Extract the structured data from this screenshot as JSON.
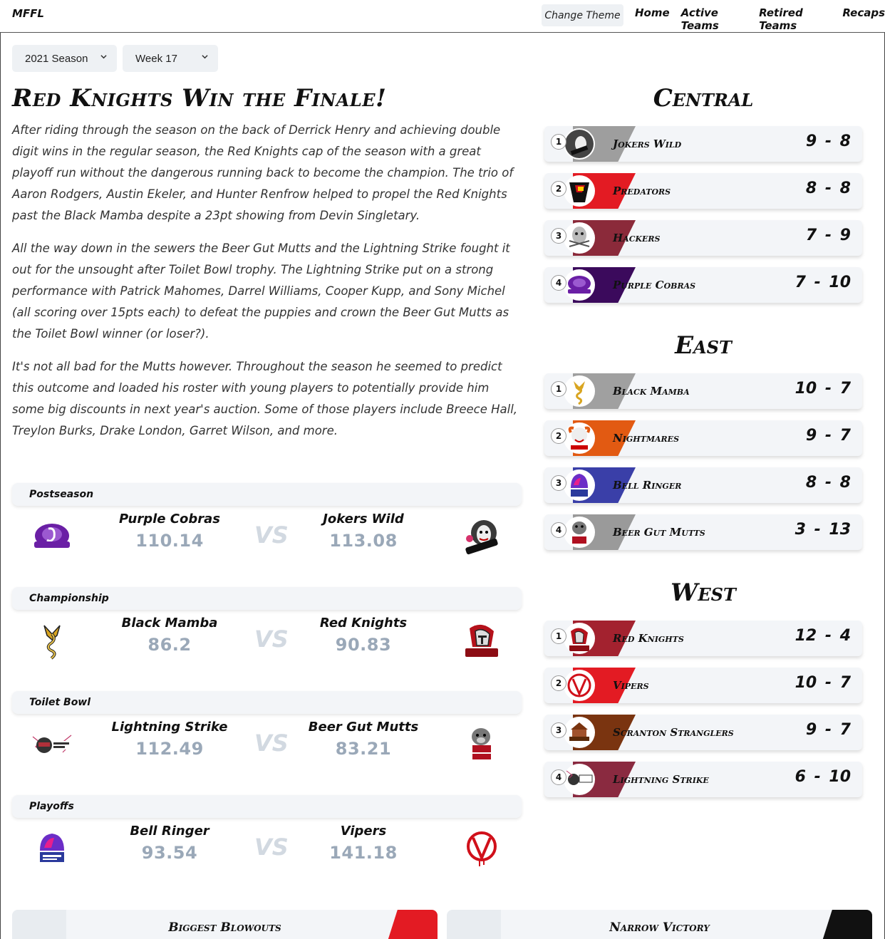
{
  "nav": {
    "brand": "MFFL",
    "change_theme": "Change Theme",
    "links": [
      "Home",
      "Active Teams",
      "Retired Teams",
      "Recaps"
    ]
  },
  "filters": {
    "season": "2021 Season",
    "week": "Week 17"
  },
  "article": {
    "headline": "Red Knights Win the Finale!",
    "paragraphs": [
      "After riding through the season on the back of Derrick Henry and achieving double digit wins in the regular season, the Red Knights cap of the season with a great playoff run without the dangerous running back to become the champion. The trio of Aaron Rodgers, Austin Ekeler, and Hunter Renfrow helped to propel the Red Knights past the Black Mamba despite a 23pt showing from Devin Singletary.",
      "All the way down in the sewers the Beer Gut Mutts and the Lightning Strike fought it out for the unsought after Toilet Bowl trophy. The Lightning Strike put on a strong performance with Patrick Mahomes, Darrel Williams, Cooper Kupp, and Sony Michel (all scoring over 15pts each) to defeat the puppies and crown the Beer Gut Mutts as the Toilet Bowl winner (or loser?).",
      "It's not all bad for the Mutts however. Throughout the season he seemed to predict this outcome and loaded his roster with young players to potentially provide him some big discounts in next year's auction. Some of those players include Breece Hall, Treylon Burks, Drake London, Garret Wilson, and more."
    ]
  },
  "matchups": [
    {
      "label": "Postseason",
      "home": "Purple Cobras",
      "home_score": "110.14",
      "away": "Jokers Wild",
      "away_score": "113.08",
      "vs": "VS",
      "home_logo": "purple-cobras-logo",
      "away_logo": "jokers-wild-logo"
    },
    {
      "label": "Championship",
      "home": "Black Mamba",
      "home_score": "86.2",
      "away": "Red Knights",
      "away_score": "90.83",
      "vs": "VS",
      "home_logo": "black-mamba-logo",
      "away_logo": "red-knights-logo"
    },
    {
      "label": "Toilet Bowl",
      "home": "Lightning Strike",
      "home_score": "112.49",
      "away": "Beer Gut Mutts",
      "away_score": "83.21",
      "vs": "VS",
      "home_logo": "lightning-strike-logo",
      "away_logo": "beer-gut-mutts-logo"
    },
    {
      "label": "Playoffs",
      "home": "Bell Ringer",
      "home_score": "93.54",
      "away": "Vipers",
      "away_score": "141.18",
      "vs": "VS",
      "home_logo": "bell-ringer-logo",
      "away_logo": "vipers-logo"
    }
  ],
  "standings": [
    {
      "division": "Central",
      "teams": [
        {
          "seed": "1",
          "name": "Jokers Wild",
          "record": "9 - 8",
          "color": "#9e9e9e"
        },
        {
          "seed": "2",
          "name": "Predators",
          "record": "8 - 8",
          "color": "#e31b23"
        },
        {
          "seed": "3",
          "name": "Hackers",
          "record": "7 - 9",
          "color": "#8b2a3a"
        },
        {
          "seed": "4",
          "name": "Purple Cobras",
          "record": "7 - 10",
          "color": "#3b0a5c"
        }
      ]
    },
    {
      "division": "East",
      "teams": [
        {
          "seed": "1",
          "name": "Black Mamba",
          "record": "10 - 7",
          "color": "#a0a0a0"
        },
        {
          "seed": "2",
          "name": "Nightmares",
          "record": "9 - 7",
          "color": "#e25a12"
        },
        {
          "seed": "3",
          "name": "Bell Ringer",
          "record": "8 - 8",
          "color": "#3a3fa8"
        },
        {
          "seed": "4",
          "name": "Beer Gut Mutts",
          "record": "3 - 13",
          "color": "#9a9a9a"
        }
      ]
    },
    {
      "division": "West",
      "teams": [
        {
          "seed": "1",
          "name": "Red Knights",
          "record": "12 - 4",
          "color": "#a3222f"
        },
        {
          "seed": "2",
          "name": "Vipers",
          "record": "10 - 7",
          "color": "#e31b23"
        },
        {
          "seed": "3",
          "name": "Scranton Stranglers",
          "record": "9 - 7",
          "color": "#7a3410"
        },
        {
          "seed": "4",
          "name": "Lightning Strike",
          "record": "6 - 10",
          "color": "#8a2a40"
        }
      ]
    }
  ],
  "cards": {
    "biggest_blowouts": "Biggest Blowouts",
    "narrow_victory": "Narrow Victory"
  }
}
